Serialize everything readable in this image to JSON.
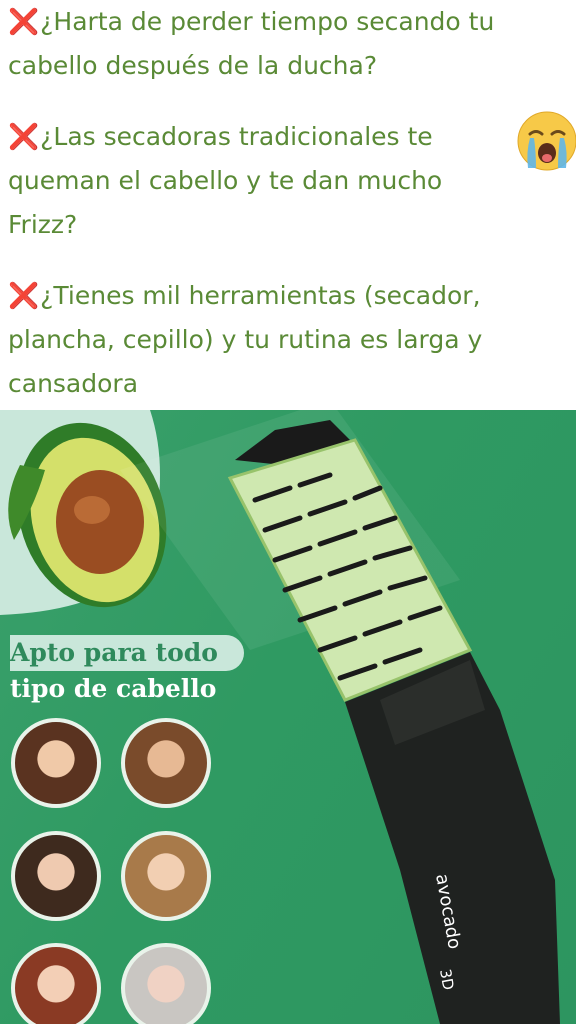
{
  "messages": [
    {
      "mark": "❌",
      "text": "¿Harta de perder tiempo secando tu cabello después de la ducha?"
    },
    {
      "mark": "❌",
      "text": "¿Las secadoras tradicionales te queman el cabello y te dan mucho Frizz?"
    },
    {
      "mark": "❌",
      "text": "¿Tienes mil herramientas (secador, plancha, cepillo) y tu rutina es larga y cansadora"
    }
  ],
  "emoji": {
    "icon": "loudly-crying-face-icon"
  },
  "product": {
    "badge_line1": "Apto para todo",
    "badge_line2": "tipo de cabello",
    "brand": "avocado",
    "model": "3D",
    "colors": {
      "background": "#2f9a62",
      "accent": "#cfe8b0",
      "text": "#5a8a36",
      "mark": "#e0242d"
    }
  }
}
